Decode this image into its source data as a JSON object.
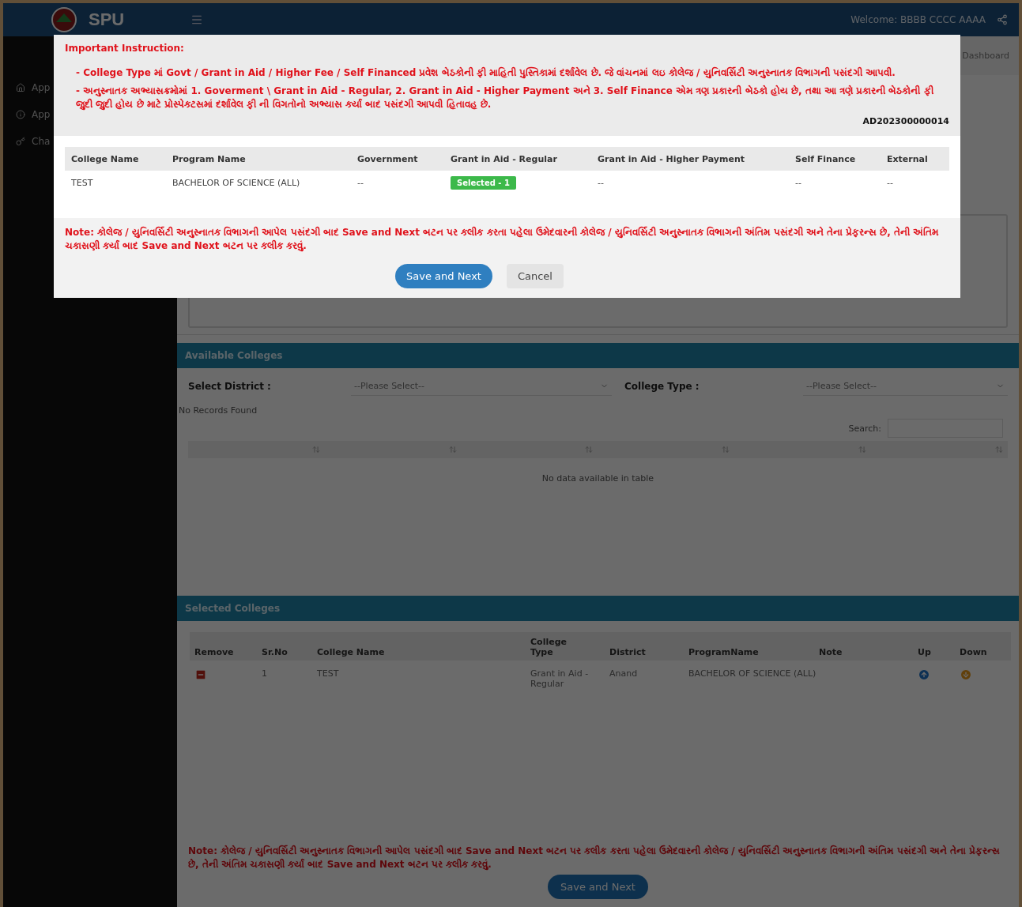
{
  "header": {
    "logo": "SPU",
    "welcome": "Welcome: BBBB CCCC AAAA"
  },
  "breadcrumb": {
    "current": "Dashboard"
  },
  "sidebar": {
    "items": [
      {
        "kind": "home",
        "label": "App"
      },
      {
        "kind": "info",
        "label": "App"
      },
      {
        "kind": "key",
        "label": "Cha"
      }
    ]
  },
  "available_colleges": {
    "title": "Available Colleges",
    "filters": [
      {
        "label": "Select District :",
        "placeholder": "--Please Select--"
      },
      {
        "label": "College Type :",
        "placeholder": "--Please Select--"
      }
    ],
    "no_records": "No Records Found",
    "search_label": "Search:",
    "empty_message": "No data available in table"
  },
  "selected_colleges": {
    "title": "Selected Colleges",
    "columns": [
      "Remove",
      "Sr.No",
      "College Name",
      "College Type",
      "District",
      "ProgramName",
      "Note",
      "Up",
      "Down"
    ],
    "rows": [
      {
        "sr_no": "1",
        "college_name": "TEST",
        "college_type": "Grant in Aid - Regular",
        "district": "Anand",
        "program_name": "BACHELOR OF SCIENCE (ALL)"
      }
    ]
  },
  "bottom_note": "Note: કોલેજ / યુનિવર્સિટી અનુસ્નાતક વિભાગની આપેલ પસંદગી બાદ Save and Next બટન પર ક્લીક કરતા પહેલા ઉમેદવારની કોલેજ / યુનિવર્સિટી અનુસ્નાતક વિભાગની અંતિમ પસંદગી અને તેના પ્રેફરન્સ છે, તેની અંતિમ ચકાસણી કર્યા બાદ Save and Next બટન પર ક્લીક કરવું.",
  "bottom_button": "Save and Next",
  "modal": {
    "title": "Important Instruction:",
    "instructions": [
      "- College Type માં Govt / Grant in Aid / Higher Fee / Self Financed પ્રવેશ બેઠકોની ફી માહિતી પુસ્તિકામાં દર્શાવેલ છે. જે વાંચનમાં લઇ કોલેજ / યુનિવર્સિટી અનુસ્નાતક વિભાગની પસંદગી આપવી.",
      "- અનુસ્નાતક અભ્યાસક્રમોમાં 1. Goverment \\ Grant in Aid - Regular, 2. Grant in Aid - Higher Payment અને 3. Self Finance એમ ત્રણ પ્રકારની બેઠકો હોય છે, તથા આ ત્રણે પ્રકારની બેઠકોની ફી જુદી જુદી હોય છે માટે પ્રોસ્પેક્ટસમાં દર્શાવેલ ફી ની વિગતોનો અભ્યાસ કર્યા બાદ પસંદગી આપવી હિતાવહ છે."
    ],
    "application_id": "AD202300000014",
    "columns": [
      "College Name",
      "Program Name",
      "Government",
      "Grant in Aid - Regular",
      "Grant in Aid - Higher Payment",
      "Self Finance",
      "External"
    ],
    "rows": [
      {
        "cells": [
          {
            "kind": "text",
            "text": "TEST"
          },
          {
            "kind": "text",
            "text": "BACHELOR OF SCIENCE (ALL)"
          },
          {
            "kind": "text",
            "text": "--"
          },
          {
            "kind": "badge",
            "text": "Selected - 1"
          },
          {
            "kind": "text",
            "text": "--"
          },
          {
            "kind": "text",
            "text": "--"
          },
          {
            "kind": "text",
            "text": "--"
          }
        ]
      }
    ],
    "note": "Note: કોલેજ / યુનિવર્સિટી અનુસ્નાતક વિભાગની આપેલ પસંદગી બાદ Save and Next બટન પર ક્લીક કરતા પહેલા ઉમેદવારની કોલેજ / યુનિવર્સિટી અનુસ્નાતક વિભાગની અંતિમ પસંદગી અને તેના પ્રેફરન્સ છે, તેની અંતિમ ચકાસણી કર્યા બાદ Save and Next બટન પર ક્લીક કરવું.",
    "buttons": [
      {
        "kind": "primary",
        "label": "Save and Next"
      },
      {
        "kind": "secondary",
        "label": "Cancel"
      }
    ]
  }
}
